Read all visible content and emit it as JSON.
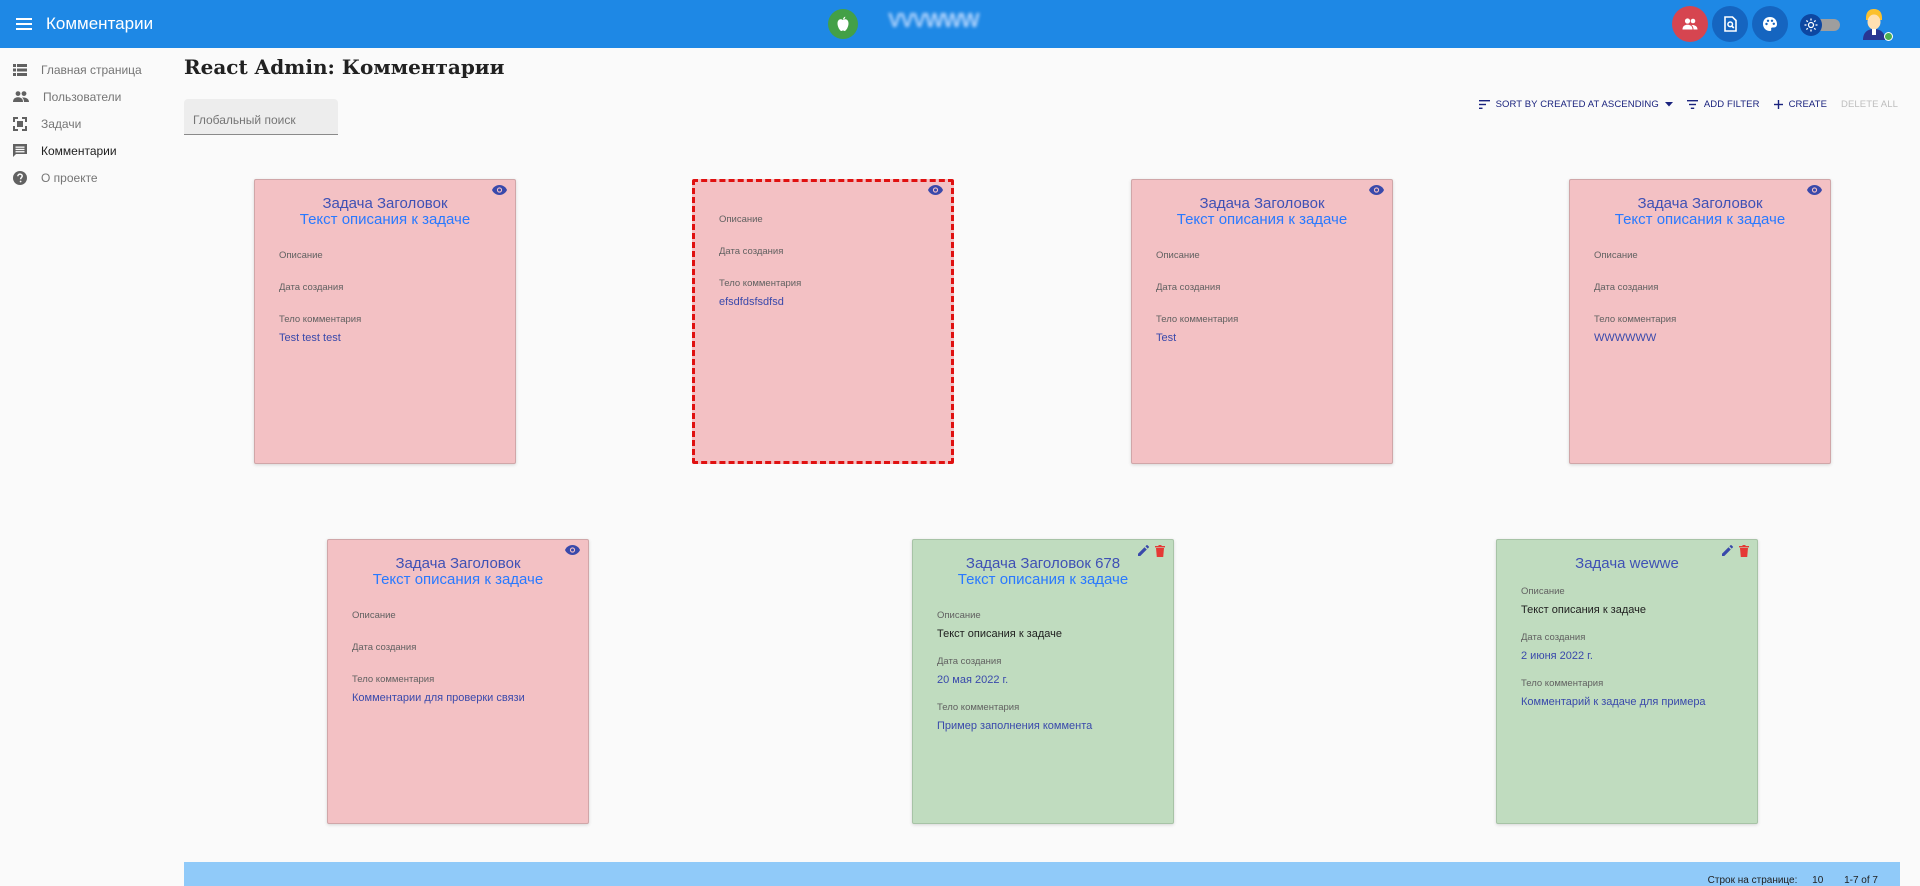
{
  "app": {
    "title": "Комментарии",
    "brand_blurred": "VVVWWW"
  },
  "sidebar": {
    "items": [
      {
        "label": "Главная страница",
        "icon": "list-icon",
        "active": false
      },
      {
        "label": "Пользователи",
        "icon": "people-icon",
        "active": false
      },
      {
        "label": "Задачи",
        "icon": "task-icon",
        "active": false
      },
      {
        "label": "Комментарии",
        "icon": "comment-icon",
        "active": true
      },
      {
        "label": "О проекте",
        "icon": "help-icon",
        "active": false
      }
    ]
  },
  "page": {
    "title": "React Admin: Комментарии"
  },
  "search": {
    "placeholder": "Глобальный поиск"
  },
  "toolbar": {
    "sort_label": "SORT BY CREATED AT ASCENDING",
    "filter_label": "ADD FILTER",
    "create_label": "CREATE",
    "delete_all_label": "DELETE ALL"
  },
  "labels": {
    "description": "Описание",
    "created": "Дата создания",
    "body": "Тело комментария"
  },
  "cards": [
    {
      "title": "Задача Заголовок",
      "subtitle": "Текст описания к задаче",
      "body": "Test test test"
    },
    {
      "body": "efsdfdsfsdfsd"
    },
    {
      "title": "Задача Заголовок",
      "subtitle": "Текст описания к задаче",
      "body": "Test"
    },
    {
      "title": "Задача Заголовок",
      "subtitle": "Текст описания к задаче",
      "body": "WWWWWW"
    },
    {
      "title": "Задача Заголовок",
      "subtitle": "Текст описания к задаче",
      "body": "Комментарии для проверки связи"
    },
    {
      "title": "Задача Заголовок 678",
      "subtitle": "Текст описания к задаче",
      "description": "Текст описания к задаче",
      "created": "20 мая 2022 г.",
      "body": "Пример заполнения коммента"
    },
    {
      "title": "Задача wewwe",
      "description": "Текст описания к задаче",
      "created": "2 июня 2022 г.",
      "body": "Комментарий к задаче для примера"
    }
  ],
  "footer": {
    "rows_label": "Строк на странице:",
    "rows_value": "10",
    "range": "1-7 of 7"
  },
  "colors": {
    "appbar": "#1e88e5",
    "card_pink": "#f3c1c4",
    "card_green": "#c0dcbf",
    "selected_border": "#e01010",
    "footer": "#90caf9"
  }
}
